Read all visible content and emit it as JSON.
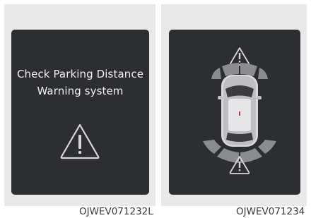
{
  "left_panel": {
    "message_line1": "Check Parking Distance",
    "message_line2": "Warning system",
    "icon": "warning-triangle-icon",
    "image_code": "OJWEV071232L"
  },
  "right_panel": {
    "icons": [
      "warning-triangle-icon",
      "car-top-view-icon",
      "warning-triangle-icon"
    ],
    "image_code": "OJWEV071234"
  }
}
